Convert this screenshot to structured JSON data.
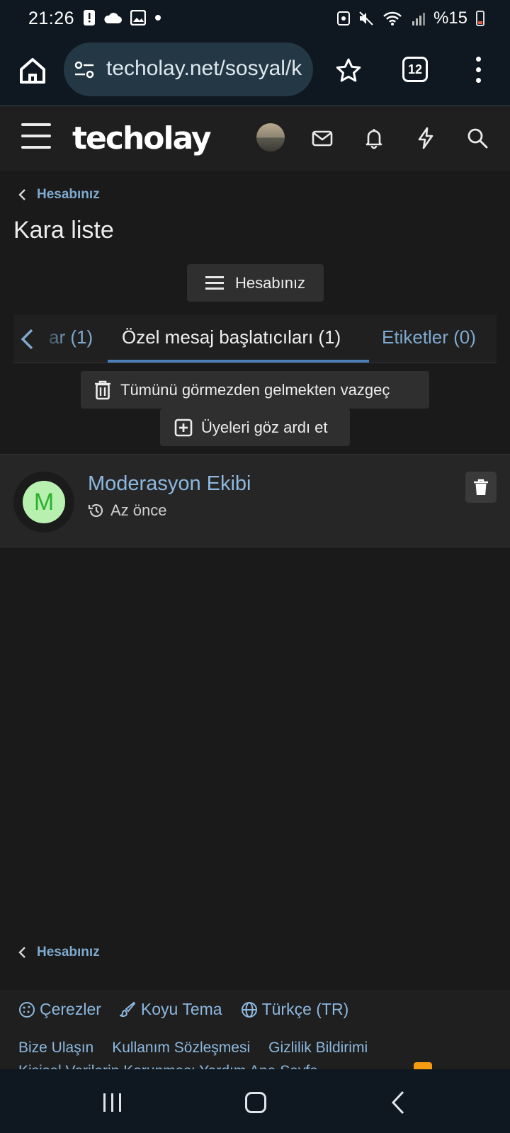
{
  "status_bar": {
    "time": "21:26",
    "battery_text": "%15",
    "icons": [
      "alert-icon",
      "cloud-icon",
      "image-icon",
      "dot-icon",
      "nfc-icon",
      "mute-icon",
      "wifi-icon",
      "signal-icon",
      "battery-icon"
    ]
  },
  "browser": {
    "url": "techolay.net/sosyal/k",
    "tab_count": "12"
  },
  "site": {
    "logo_text": "techolay",
    "header_icons": [
      "menu-icon",
      "avatar",
      "mail-icon",
      "bell-icon",
      "lightning-icon",
      "search-icon"
    ]
  },
  "breadcrumb": {
    "label": "Hesabınız"
  },
  "page": {
    "title": "Kara liste"
  },
  "account_menu_button": {
    "label": "Hesabınız"
  },
  "tabs": {
    "previous_partial": "ar (1)",
    "active": "Özel mesaj başlatıcıları (1)",
    "next": "Etiketler (0)"
  },
  "actions": {
    "unignore_all": "Tümünü görmezden gelmekten vazgeç",
    "ignore_members": "Üyeleri göz ardı et"
  },
  "members": [
    {
      "avatar_letter": "M",
      "name": "Moderasyon Ekibi",
      "time": "Az önce"
    }
  ],
  "breadcrumb_bottom": {
    "label": "Hesabınız"
  },
  "footer": {
    "cookies": "Çerezler",
    "dark_theme": "Koyu Tema",
    "language": "Türkçe (TR)",
    "links": [
      "Bize Ulaşın",
      "Kullanım Sözleşmesi",
      "Gizlilik Bildirimi"
    ],
    "partial_line": "Kişisel Verilerin Korunması   Yardım   Ana Sayfa"
  },
  "colors": {
    "link": "#7fa9cf",
    "active_tab_underline": "#4d7fb8",
    "avatar_bg": "#b8f0b0",
    "avatar_letter": "#2fb02f"
  }
}
